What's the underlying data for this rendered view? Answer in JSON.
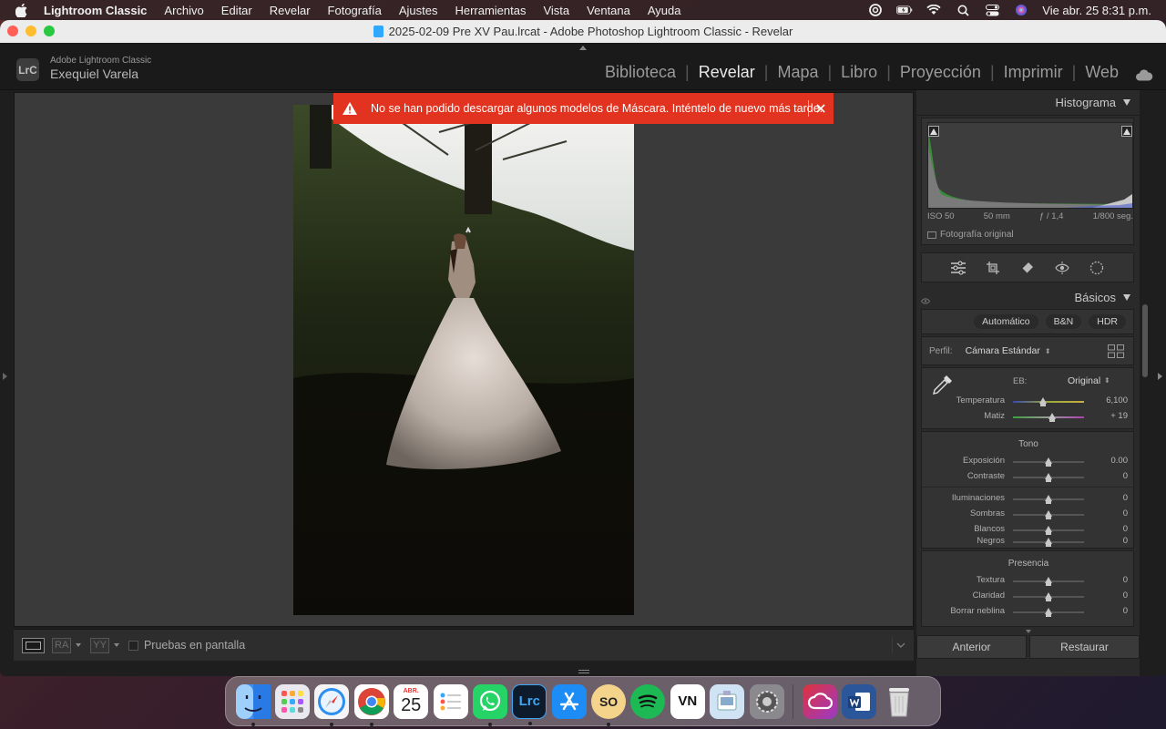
{
  "menubar": {
    "app_name": "Lightroom Classic",
    "items": [
      "Archivo",
      "Editar",
      "Revelar",
      "Fotografía",
      "Ajustes",
      "Herramientas",
      "Vista",
      "Ventana",
      "Ayuda"
    ],
    "clock": "Vie abr. 25  8:31 p.m."
  },
  "window": {
    "title": "2025-02-09 Pre XV Pau.lrcat - Adobe Photoshop Lightroom Classic - Revelar"
  },
  "identity": {
    "badge": "LrC",
    "product": "Adobe Lightroom Classic",
    "user": "Exequiel Varela"
  },
  "modules": {
    "items": [
      "Biblioteca",
      "Revelar",
      "Mapa",
      "Libro",
      "Proyección",
      "Imprimir",
      "Web"
    ],
    "separator": "|",
    "active": "Revelar"
  },
  "toast": {
    "message": "No se han podido descargar algunos modelos de Máscara. Inténtelo de nuevo más tarde."
  },
  "toolbar": {
    "ra_label": "RA",
    "yy_label": "YY",
    "softproof_label": "Pruebas en pantalla"
  },
  "histogram": {
    "title": "Histograma",
    "iso": "ISO 50",
    "focal": "50 mm",
    "aperture": "ƒ / 1,4",
    "shutter": "1/800 seg.",
    "original_label": "Fotografía original"
  },
  "basics": {
    "title": "Básicos",
    "treatments": [
      "Automático",
      "B&N",
      "HDR"
    ],
    "profile_label": "Perfil:",
    "profile_value": "Cámara Estándar",
    "wb_label": "EB:",
    "wb_value": "Original",
    "wb_sliders": [
      {
        "label": "Temperatura",
        "value": "6,100",
        "pos": 0.42
      },
      {
        "label": "Matiz",
        "value": "+ 19",
        "pos": 0.55
      }
    ],
    "tone_title": "Tono",
    "tone_sliders": [
      {
        "label": "Exposición",
        "value": "0.00",
        "pos": 0.5
      },
      {
        "label": "Contraste",
        "value": "0",
        "pos": 0.5
      }
    ],
    "tone_sliders2": [
      {
        "label": "Iluminaciones",
        "value": "0",
        "pos": 0.5
      },
      {
        "label": "Sombras",
        "value": "0",
        "pos": 0.5
      },
      {
        "label": "Blancos",
        "value": "0",
        "pos": 0.5
      },
      {
        "label": "Negros",
        "value": "0",
        "pos": 0.5
      }
    ],
    "presence_title": "Presencia",
    "presence_sliders": [
      {
        "label": "Textura",
        "value": "0",
        "pos": 0.5
      },
      {
        "label": "Claridad",
        "value": "0",
        "pos": 0.5
      },
      {
        "label": "Borrar neblina",
        "value": "0",
        "pos": 0.5
      }
    ]
  },
  "buttons": {
    "previous": "Anterior",
    "reset": "Restaurar"
  },
  "dock": {
    "calendar_month": "ABR.",
    "calendar_day": "25",
    "lrc_label": "Lrc",
    "so_label": "SO",
    "vn_label": "VN",
    "apps": [
      {
        "name": "finder",
        "color": "#3d8ff5"
      },
      {
        "name": "launchpad",
        "color": "#e8e8ee"
      },
      {
        "name": "safari",
        "color": "#f5f5f8"
      },
      {
        "name": "chrome",
        "color": "#ffffff"
      },
      {
        "name": "calendar",
        "color": "#ffffff"
      },
      {
        "name": "reminders",
        "color": "#ffffff"
      },
      {
        "name": "whatsapp",
        "color": "#25d366"
      },
      {
        "name": "lightroom-classic",
        "color": "#0e1b2c"
      },
      {
        "name": "app-store",
        "color": "#1e8cf5"
      },
      {
        "name": "so-app",
        "color": "#f4d48a"
      },
      {
        "name": "spotify",
        "color": "#1db954"
      },
      {
        "name": "vn-editor",
        "color": "#ffffff"
      },
      {
        "name": "preview",
        "color": "#cfe3f5"
      },
      {
        "name": "system-settings",
        "color": "#8a8a8e"
      },
      {
        "name": "creative-cloud",
        "color": "#e0323a"
      },
      {
        "name": "word",
        "color": "#2b579a"
      },
      {
        "name": "trash",
        "color": "#dcdcdc"
      }
    ]
  }
}
